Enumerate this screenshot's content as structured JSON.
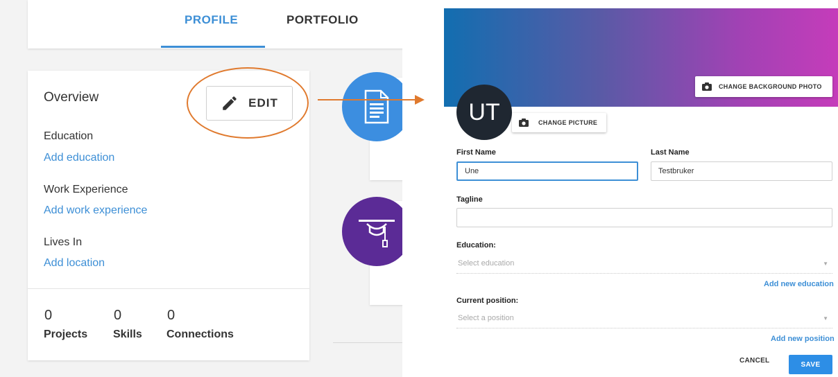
{
  "tabs": {
    "profile_label": "PROFILE",
    "portfolio_label": "PORTFOLIO"
  },
  "overview": {
    "title": "Overview",
    "edit_label": "EDIT",
    "education_label": "Education",
    "education_link": "Add education",
    "work_label": "Work Experience",
    "work_link": "Add work experience",
    "lives_label": "Lives In",
    "lives_link": "Add location",
    "stats": [
      {
        "count": "0",
        "label": "Projects"
      },
      {
        "count": "0",
        "label": "Skills"
      },
      {
        "count": "0",
        "label": "Connections"
      }
    ]
  },
  "icons": {
    "pencil": "pencil-icon",
    "document": "document-icon",
    "graduation": "graduation-cap-icon",
    "camera": "camera-icon"
  },
  "edit_form": {
    "change_background_label": "CHANGE BACKGROUND PHOTO",
    "avatar_initials": "UT",
    "change_picture_label": "CHANGE PICTURE",
    "first_name_label": "First Name",
    "first_name_value": "Une",
    "last_name_label": "Last Name",
    "last_name_value": "Testbruker",
    "tagline_label": "Tagline",
    "tagline_value": "",
    "education_label": "Education:",
    "education_placeholder": "Select education",
    "add_education_link": "Add new education",
    "position_label": "Current position:",
    "position_placeholder": "Select a position",
    "add_position_link": "Add new position",
    "cancel_label": "CANCEL",
    "save_label": "SAVE"
  },
  "colors": {
    "accent": "#3d8fd6",
    "highlight": "#e07a2e",
    "save": "#2d8ee6",
    "banner_start": "#126eb0",
    "banner_end": "#c53cba"
  }
}
